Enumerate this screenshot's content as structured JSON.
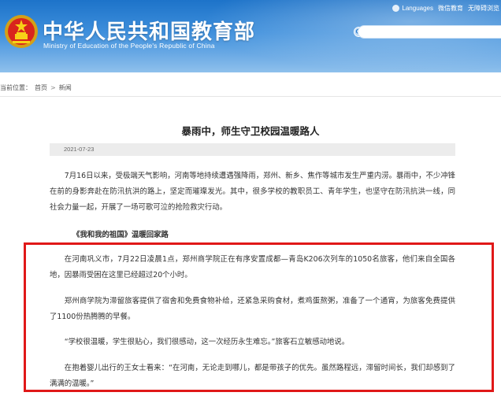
{
  "header": {
    "title": "中华人民共和国教育部",
    "subtitle": "Ministry of Education of the People's Republic of China",
    "top_links": [
      "Languages",
      "微信教育",
      "无障碍浏览"
    ],
    "search": {
      "placeholder": ""
    },
    "colors": {
      "banner_top": "#1d73c9",
      "banner_bottom": "#8fc0ec"
    }
  },
  "breadcrumb": {
    "prefix": "当前位置：",
    "items": [
      "首页",
      "新闻"
    ],
    "separator": ">"
  },
  "article": {
    "title": "暴雨中，师生守卫校园温暖路人",
    "date": "2021-07-23",
    "paragraphs": [
      "7月16日以来，受极端天气影响，河南等地持续遭遇强降雨，郑州、新乡、焦作等城市发生严重内涝。暴雨中，不少冲锋在前的身影奔赴在防汛抗洪的路上，坚定而璀璨发光。其中，很多学校的教职员工、青年学生，也坚守在防汛抗洪一线，同社会力量一起，开展了一场可歌可泣的抢险救灾行动。",
      "在河南巩义市，7月22日凌晨1点，郑州商学院正在有序安置成都—青岛K206次列车的1050名旅客，他们来自全国各地，因暴雨受困在这里已经超过20个小时。",
      "郑州商学院为滞留旅客提供了宿舍和免费食物补给，还紧急采购食材，煮鸡蛋熬粥，准备了一个通宵，为旅客免费提供了1100份热腾腾的早餐。",
      "“学校很温暖，学生很贴心，我们很感动，这一次经历永生难忘。”旅客石立敏感动地说。",
      "在抱着婴儿出行的王女士看来：“在河南，无论走到哪儿，都是带孩子的优先。虽然路程远，滞留时间长，我们却感到了满满的温暖。”"
    ],
    "section_title": "《我和我的祖国》温暖回家路",
    "highlight_color": "#e01818"
  }
}
